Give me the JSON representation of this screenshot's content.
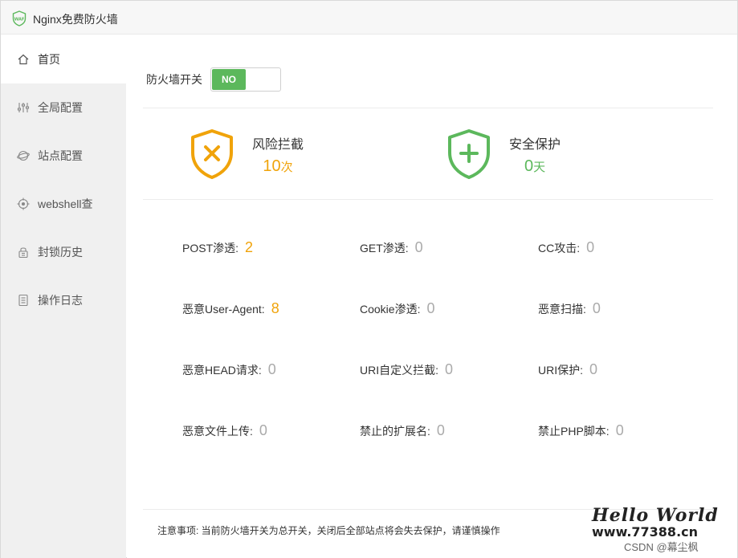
{
  "window": {
    "title": "Nginx免费防火墙",
    "logo_text": "WAF"
  },
  "sidebar": {
    "items": [
      {
        "label": "首页",
        "icon": "home-icon",
        "active": true
      },
      {
        "label": "全局配置",
        "icon": "sliders-icon",
        "active": false
      },
      {
        "label": "站点配置",
        "icon": "globe-icon",
        "active": false
      },
      {
        "label": "webshell查",
        "icon": "target-icon",
        "active": false
      },
      {
        "label": "封锁历史",
        "icon": "lock-icon",
        "active": false
      },
      {
        "label": "操作日志",
        "icon": "log-icon",
        "active": false
      }
    ]
  },
  "firewall": {
    "label": "防火墙开关",
    "toggle_text": "NO"
  },
  "stats": {
    "risk": {
      "title": "风险拦截",
      "value": "10",
      "unit": "次"
    },
    "safe": {
      "title": "安全保护",
      "value": "0",
      "unit": "天"
    }
  },
  "grid": [
    {
      "label": "POST渗透:",
      "value": "2"
    },
    {
      "label": "GET渗透:",
      "value": "0"
    },
    {
      "label": "CC攻击:",
      "value": "0"
    },
    {
      "label": "恶意User-Agent:",
      "value": "8"
    },
    {
      "label": "Cookie渗透:",
      "value": "0"
    },
    {
      "label": "恶意扫描:",
      "value": "0"
    },
    {
      "label": "恶意HEAD请求:",
      "value": "0"
    },
    {
      "label": "URI自定义拦截:",
      "value": "0"
    },
    {
      "label": "URI保护:",
      "value": "0"
    },
    {
      "label": "恶意文件上传:",
      "value": "0"
    },
    {
      "label": "禁止的扩展名:",
      "value": "0"
    },
    {
      "label": "禁止PHP脚本:",
      "value": "0"
    }
  ],
  "notice": "注意事项: 当前防火墙开关为总开关，关闭后全部站点将会失去保护，请谨慎操作",
  "watermark": {
    "line1": "Hello World",
    "line2": "www.77388.cn",
    "csdn": "CSDN @幕尘枫"
  },
  "colors": {
    "accent_green": "#5cb85c",
    "accent_orange": "#f0a30a",
    "muted_value": "#aaaaaa"
  }
}
